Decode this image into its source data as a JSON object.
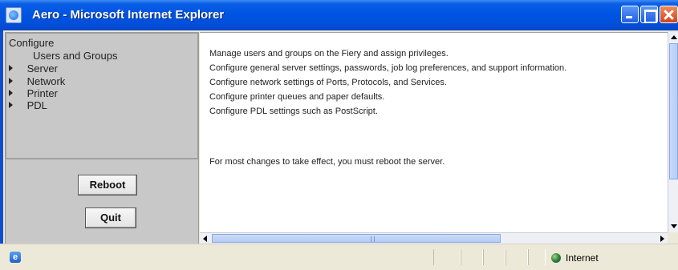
{
  "window": {
    "title": "Aero - Microsoft Internet Explorer",
    "icon": "ie-window-icon",
    "controls": [
      "minimize-icon",
      "maximize-icon",
      "close-icon"
    ]
  },
  "sidebar": {
    "root_label": "Configure",
    "items": [
      {
        "label": "Users and Groups",
        "expandable": false
      },
      {
        "label": "Server",
        "expandable": true
      },
      {
        "label": "Network",
        "expandable": true
      },
      {
        "label": "Printer",
        "expandable": true
      },
      {
        "label": "PDL",
        "expandable": true
      }
    ]
  },
  "buttons": {
    "reboot_label": "Reboot",
    "quit_label": "Quit"
  },
  "content": {
    "lines": [
      "Manage users and groups on the Fiery and assign privileges.",
      "Configure general server settings, passwords, job log preferences, and support information.",
      "Configure network settings of Ports, Protocols, and Services.",
      "Configure printer queues and paper defaults.",
      "Configure PDL settings such as PostScript."
    ],
    "note": "For most changes to take effect, you must reboot the server."
  },
  "statusbar": {
    "zone_label": "Internet",
    "zone_icon": "globe-icon"
  },
  "colors": {
    "titlebar": "#0054e3",
    "panel": "#c8c8c8",
    "chrome": "#ece9d8"
  }
}
